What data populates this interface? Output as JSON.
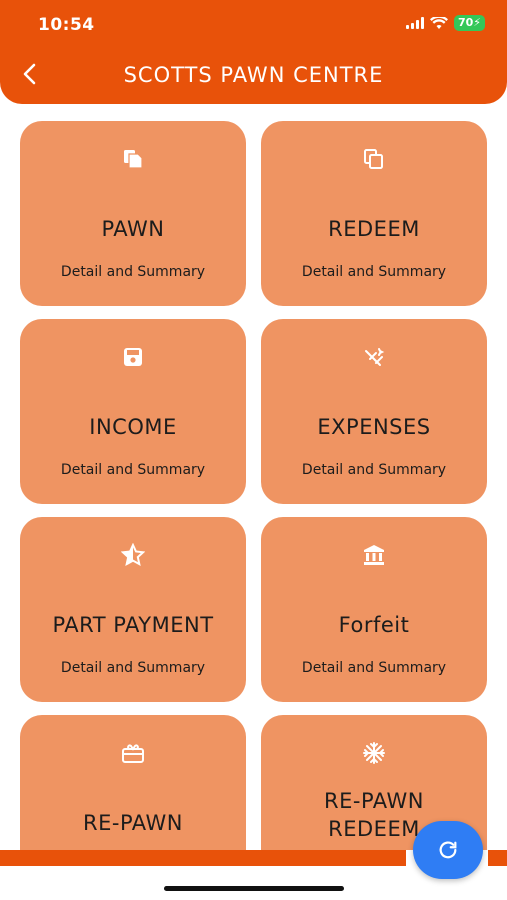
{
  "status_bar": {
    "time": "10:54",
    "battery": "70"
  },
  "header": {
    "title": "SCOTTS PAWN CENTRE",
    "back_icon": "chevron-left-icon"
  },
  "cards": [
    {
      "title": "PAWN",
      "subtitle": "Detail and Summary",
      "icon": "copy-file-icon"
    },
    {
      "title": "REDEEM",
      "subtitle": "Detail and Summary",
      "icon": "copy-outline-icon"
    },
    {
      "title": "INCOME",
      "subtitle": "Detail and Summary",
      "icon": "save-icon"
    },
    {
      "title": "EXPENSES",
      "subtitle": "Detail and Summary",
      "icon": "wand-off-icon"
    },
    {
      "title": "PART PAYMENT",
      "subtitle": "Detail and Summary",
      "icon": "half-star-icon"
    },
    {
      "title": "Forfeit",
      "subtitle": "Detail and Summary",
      "icon": "bank-icon"
    },
    {
      "title": "RE-PAWN",
      "subtitle": "",
      "icon": "gift-card-icon"
    },
    {
      "title": "RE-PAWN REDEEM",
      "subtitle": "",
      "icon": "snowflake-icon"
    }
  ],
  "fab": {
    "icon": "refresh-icon"
  },
  "colors": {
    "primary": "#e8520a",
    "card": "#ef9462",
    "fab": "#2f7df4"
  }
}
